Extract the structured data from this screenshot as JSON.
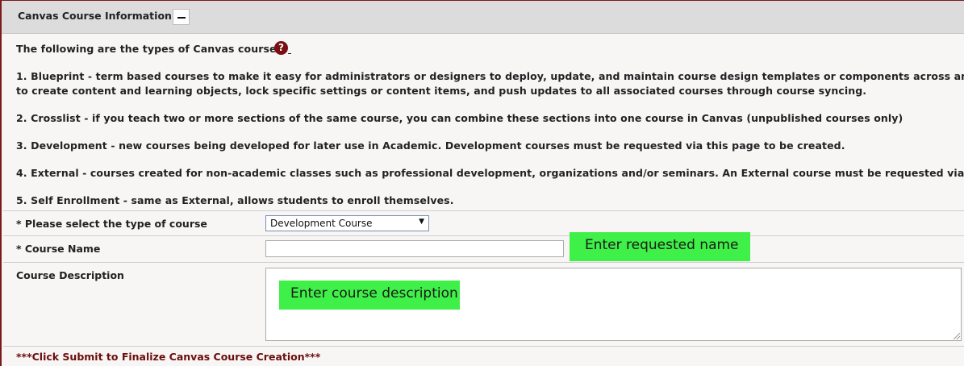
{
  "section": {
    "title": "Canvas Course Information",
    "collapse_icon": "minus-icon"
  },
  "intro": {
    "heading": "The following are the types of Canvas courses:",
    "help_icon": "question-circle-icon",
    "help_glyph": "?"
  },
  "course_types": [
    {
      "line1": "1. Blueprint - term based courses to make it easy for administrators or designers to deploy, update, and maintain course design templates or components across any number",
      "line2": "to create content and learning objects, lock specific settings or content items, and push updates to all associated courses through course syncing."
    },
    {
      "line1": "2. Crosslist - if you teach two or more sections of the same course, you can combine these sections into one course in Canvas (unpublished courses only)"
    },
    {
      "line1": "3. Development - new courses being developed for later use in Academic. Development courses must be requested via this page to be created."
    },
    {
      "line1": "4. External - courses created for non-academic classes such as professional development, organizations and/or seminars. An External course must be requested via this page"
    },
    {
      "line1": "5. Self Enrollment - same as External, allows students to enroll themselves."
    }
  ],
  "form": {
    "course_type_label": "* Please select the type of course",
    "course_type_value": "Development Course",
    "course_name_label": "* Course Name",
    "course_name_value": "",
    "course_desc_label": "Course Description",
    "course_desc_value": ""
  },
  "annotations": {
    "name_callout": "Enter requested name",
    "desc_callout": "Enter course description"
  },
  "submit_note": "***Click Submit to Finalize Canvas Course Creation***",
  "colors": {
    "accent_maroon": "#7a1a1a",
    "callout_green": "#3ef047",
    "header_gray": "#dcdcdc"
  }
}
